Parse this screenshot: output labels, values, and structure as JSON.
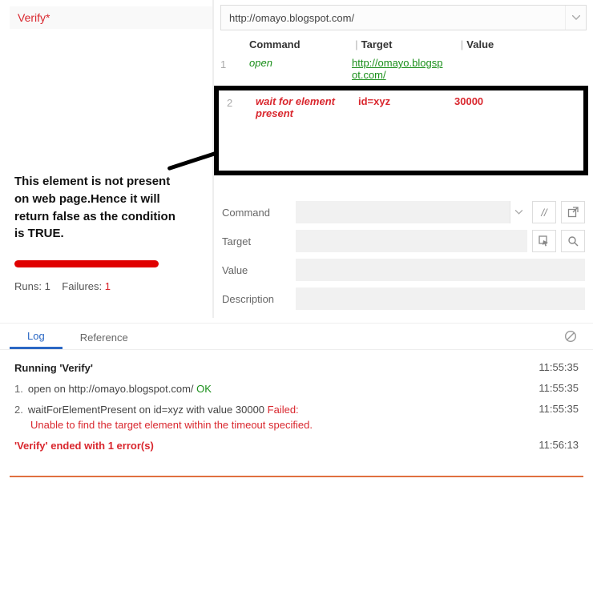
{
  "test_title": "Verify*",
  "annotation_text": "This element is not present on web page.Hence it will return false as the condition is TRUE.",
  "runs_label": "Runs:",
  "runs_count": "1",
  "failures_label": "Failures:",
  "failures_count": "1",
  "base_url": "http://omayo.blogspot.com/",
  "grid": {
    "headers": {
      "command": "Command",
      "target": "Target",
      "value": "Value"
    },
    "rows": [
      {
        "idx": "1",
        "command": "open",
        "target": "http://omayo.blogspot.com/",
        "value": ""
      },
      {
        "idx": "2",
        "command": "wait for element present",
        "target": "id=xyz",
        "value": "30000"
      }
    ]
  },
  "editor": {
    "command_label": "Command",
    "target_label": "Target",
    "value_label": "Value",
    "description_label": "Description"
  },
  "icons": {
    "disable": "//",
    "new_window": "new-window-icon",
    "select_in_page": "select-target-icon",
    "search": "search-icon",
    "chevron": "chevron-down-icon",
    "clear": "clear-icon"
  },
  "tabs": {
    "log": "Log",
    "reference": "Reference"
  },
  "log": [
    {
      "kind": "running",
      "msg_prefix": "Running ",
      "msg_quote": "'Verify'",
      "ts": "11:55:35"
    },
    {
      "kind": "step_ok",
      "num": "1.",
      "text": "open on http://omayo.blogspot.com/ ",
      "status": "OK",
      "ts": "11:55:35"
    },
    {
      "kind": "step_fail",
      "num": "2.",
      "text": "waitForElementPresent on id=xyz with value 30000 ",
      "status": "Failed:",
      "detail": "Unable to find the target element within the timeout specified.",
      "ts": "11:55:35"
    },
    {
      "kind": "end",
      "msg": "'Verify' ended with 1 error(s)",
      "ts": "11:56:13"
    }
  ]
}
